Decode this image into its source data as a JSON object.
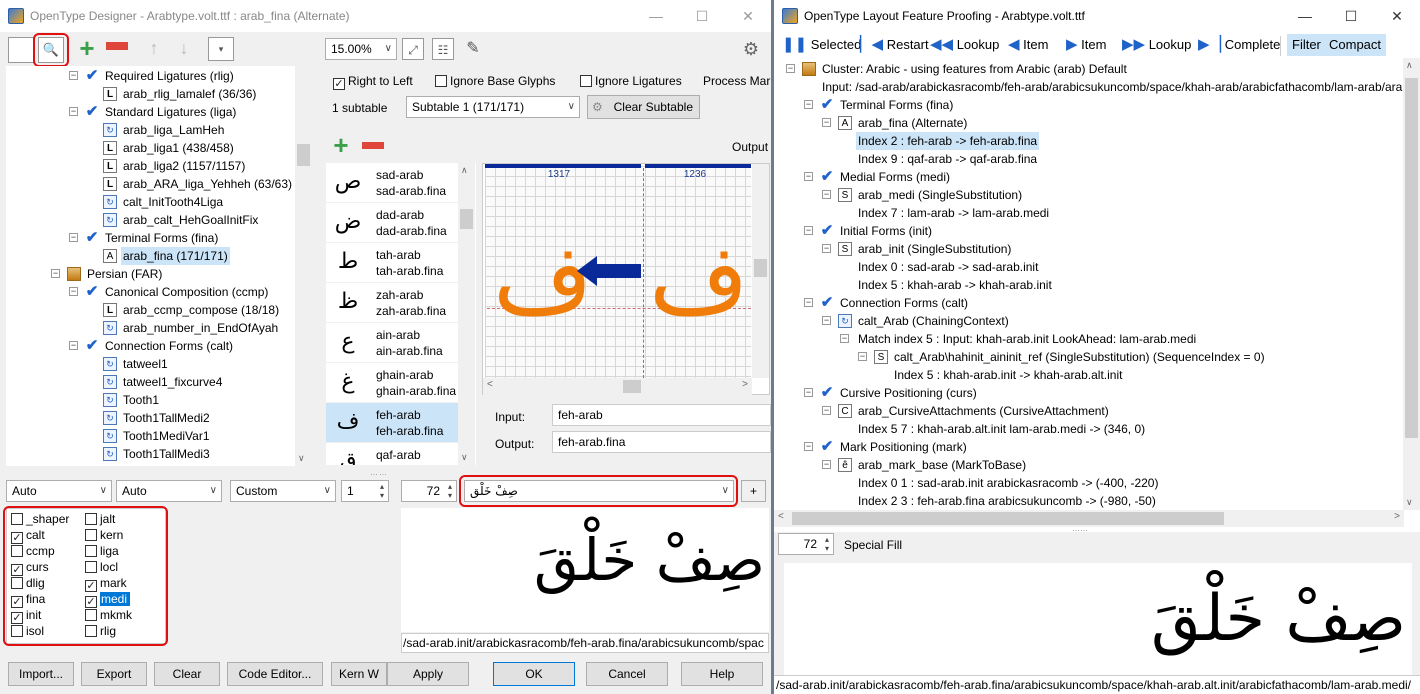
{
  "left_window": {
    "title": "OpenType Designer - Arabtype.volt.ttf : arab_fina (Alternate)",
    "zoom": "15.00%",
    "options": {
      "right_to_left": "Right to Left",
      "ignore_base_glyphs": "Ignore Base Glyphs",
      "ignore_ligatures": "Ignore Ligatures",
      "process_marks": "Process Mark"
    },
    "subtable_count": "1 subtable",
    "subtable_select": "Subtable 1 (171/171)",
    "clear_subtable": "Clear Subtable",
    "output_label": "Output",
    "tree": [
      {
        "label": "Required Ligatures (rlig)",
        "level": 1,
        "icon": "check",
        "toggle": "-"
      },
      {
        "label": "arab_rlig_lamalef (36/36)",
        "level": 2,
        "icon": "L"
      },
      {
        "label": "Standard Ligatures (liga)",
        "level": 1,
        "icon": "check",
        "toggle": "-"
      },
      {
        "label": "arab_liga_LamHeh",
        "level": 2,
        "icon": "sub"
      },
      {
        "label": "arab_liga1 (438/458)",
        "level": 2,
        "icon": "L"
      },
      {
        "label": "arab_liga2 (1157/1157)",
        "level": 2,
        "icon": "L"
      },
      {
        "label": "arab_ARA_liga_Yehheh (63/63)",
        "level": 2,
        "icon": "L"
      },
      {
        "label": "calt_InitTooth4Liga",
        "level": 2,
        "icon": "sub"
      },
      {
        "label": "arab_calt_HehGoalInitFix",
        "level": 2,
        "icon": "sub"
      },
      {
        "label": "Terminal Forms (fina)",
        "level": 1,
        "icon": "check",
        "toggle": "-"
      },
      {
        "label": "arab_fina (171/171)",
        "level": 2,
        "icon": "A",
        "selected": true
      },
      {
        "label": "Persian (FAR)",
        "level": 0,
        "icon": "lang",
        "toggle": "-"
      },
      {
        "label": "Canonical Composition (ccmp)",
        "level": 1,
        "icon": "check",
        "toggle": "-"
      },
      {
        "label": "arab_ccmp_compose (18/18)",
        "level": 2,
        "icon": "L"
      },
      {
        "label": "arab_number_in_EndOfAyah",
        "level": 2,
        "icon": "sub"
      },
      {
        "label": "Connection Forms (calt)",
        "level": 1,
        "icon": "check",
        "toggle": "-"
      },
      {
        "label": "tatweel1",
        "level": 2,
        "icon": "sub"
      },
      {
        "label": "tatweel1_fixcurve4",
        "level": 2,
        "icon": "sub"
      },
      {
        "label": "Tooth1",
        "level": 2,
        "icon": "sub"
      },
      {
        "label": "Tooth1TallMedi2",
        "level": 2,
        "icon": "sub"
      },
      {
        "label": "Tooth1MediVar1",
        "level": 2,
        "icon": "sub"
      },
      {
        "label": "Tooth1TallMedi3",
        "level": 2,
        "icon": "sub"
      }
    ],
    "glyphs": [
      {
        "sym": "ص",
        "in": "sad-arab",
        "out": "sad-arab.fina"
      },
      {
        "sym": "ض",
        "in": "dad-arab",
        "out": "dad-arab.fina"
      },
      {
        "sym": "ط",
        "in": "tah-arab",
        "out": "tah-arab.fina"
      },
      {
        "sym": "ظ",
        "in": "zah-arab",
        "out": "zah-arab.fina"
      },
      {
        "sym": "ع",
        "in": "ain-arab",
        "out": "ain-arab.fina"
      },
      {
        "sym": "غ",
        "in": "ghain-arab",
        "out": "ghain-arab.fina"
      },
      {
        "sym": "ف",
        "in": "feh-arab",
        "out": "feh-arab.fina",
        "selected": true
      },
      {
        "sym": "ق",
        "in": "qaf-arab",
        "out": ""
      }
    ],
    "preview": {
      "adv1": "1317",
      "adv2": "1236",
      "glyph_left": "ف",
      "glyph_right": "ف"
    },
    "input_label": "Input:",
    "input_value": "feh-arab",
    "output_field_label": "Output:",
    "output_value": "feh-arab.fina",
    "bottom_combos": {
      "script": "Auto",
      "lang": "Auto",
      "mode": "Custom",
      "count": "1",
      "size": "72",
      "text": "صِفْ خَلْق"
    },
    "plus_label": "+",
    "features": [
      {
        "tag": "_shaper",
        "checked": false
      },
      {
        "tag": "calt",
        "checked": true
      },
      {
        "tag": "ccmp",
        "checked": false
      },
      {
        "tag": "curs",
        "checked": true
      },
      {
        "tag": "dlig",
        "checked": false
      },
      {
        "tag": "fina",
        "checked": true
      },
      {
        "tag": "init",
        "checked": true
      },
      {
        "tag": "isol",
        "checked": false
      },
      {
        "tag": "jalt",
        "checked": false
      },
      {
        "tag": "kern",
        "checked": false
      },
      {
        "tag": "liga",
        "checked": false
      },
      {
        "tag": "locl",
        "checked": false
      },
      {
        "tag": "mark",
        "checked": true
      },
      {
        "tag": "medi",
        "checked": true,
        "selected": true
      },
      {
        "tag": "mkmk",
        "checked": false
      },
      {
        "tag": "rlig",
        "checked": false
      }
    ],
    "preview_text": "صِفْ خَلْقَ",
    "glyph_path": "/sad-arab.init/arabickasracomb/feh-arab.fina/arabicsukuncomb/spac",
    "buttons": {
      "import": "Import...",
      "export": "Export",
      "clear": "Clear",
      "code_editor": "Code Editor...",
      "kern": "Kern W",
      "apply": "Apply",
      "ok": "OK",
      "cancel": "Cancel",
      "help": "Help"
    }
  },
  "right_window": {
    "title": "OpenType Layout Feature Proofing - Arabtype.volt.ttf",
    "toolbar": {
      "selected": "Selected",
      "restart": "Restart",
      "lookup_back": "Lookup",
      "item_back": "Item",
      "item_fwd": "Item",
      "lookup_fwd": "Lookup",
      "complete": "Complete",
      "filter": "Filter",
      "compact": "Compact"
    },
    "tree": [
      {
        "label": "Cluster: Arabic - using features from Arabic (arab) Default",
        "level": 0,
        "icon": "lang",
        "toggle": "-"
      },
      {
        "label": "Input: /sad-arab/arabickasracomb/feh-arab/arabicsukuncomb/space/khah-arab/arabicfathacomb/lam-arab/ara",
        "level": 1,
        "icon": ""
      },
      {
        "label": "Terminal Forms (fina)",
        "level": 1,
        "icon": "check",
        "toggle": "-"
      },
      {
        "label": "arab_fina (Alternate)",
        "level": 2,
        "icon": "A",
        "toggle": "-"
      },
      {
        "label": "Index 2 : feh-arab -> feh-arab.fina",
        "level": 3,
        "icon": "",
        "selected": true
      },
      {
        "label": "Index 9 : qaf-arab -> qaf-arab.fina",
        "level": 3,
        "icon": ""
      },
      {
        "label": "Medial Forms (medi)",
        "level": 1,
        "icon": "check",
        "toggle": "-"
      },
      {
        "label": "arab_medi (SingleSubstitution)",
        "level": 2,
        "icon": "S",
        "toggle": "-"
      },
      {
        "label": "Index 7 : lam-arab -> lam-arab.medi",
        "level": 3,
        "icon": ""
      },
      {
        "label": "Initial Forms (init)",
        "level": 1,
        "icon": "check",
        "toggle": "-"
      },
      {
        "label": "arab_init (SingleSubstitution)",
        "level": 2,
        "icon": "S",
        "toggle": "-"
      },
      {
        "label": "Index 0 : sad-arab -> sad-arab.init",
        "level": 3,
        "icon": ""
      },
      {
        "label": "Index 5 : khah-arab -> khah-arab.init",
        "level": 3,
        "icon": ""
      },
      {
        "label": "Connection Forms (calt)",
        "level": 1,
        "icon": "check",
        "toggle": "-"
      },
      {
        "label": "calt_Arab (ChainingContext)",
        "level": 2,
        "icon": "sub",
        "toggle": "-"
      },
      {
        "label": "Match index 5 : Input: khah-arab.init LookAhead: lam-arab.medi",
        "level": 3,
        "icon": "",
        "toggle": "-"
      },
      {
        "label": "calt_Arab\\hahinit_aininit_ref (SingleSubstitution) (SequenceIndex = 0)",
        "level": 4,
        "icon": "S",
        "toggle": "-"
      },
      {
        "label": "Index 5 : khah-arab.init -> khah-arab.alt.init",
        "level": 5,
        "icon": ""
      },
      {
        "label": "Cursive Positioning (curs)",
        "level": 1,
        "icon": "check",
        "toggle": "-"
      },
      {
        "label": "arab_CursiveAttachments (CursiveAttachment)",
        "level": 2,
        "icon": "C",
        "toggle": "-"
      },
      {
        "label": "Index 5 7 : khah-arab.alt.init lam-arab.medi -> (346, 0)",
        "level": 3,
        "icon": ""
      },
      {
        "label": "Mark Positioning (mark)",
        "level": 1,
        "icon": "check",
        "toggle": "-"
      },
      {
        "label": "arab_mark_base (MarkToBase)",
        "level": 2,
        "icon": "ê",
        "toggle": "-"
      },
      {
        "label": "Index 0 1 : sad-arab.init arabickasracomb -> (-400, -220)",
        "level": 3,
        "icon": ""
      },
      {
        "label": "Index 2 3 : feh-arab.fina arabicsukuncomb -> (-980, -50)",
        "level": 3,
        "icon": ""
      }
    ],
    "font_size": "72",
    "special_fill": "Special Fill",
    "preview_text": "صِفْ خَلْقَ",
    "glyph_path": "/sad-arab.init/arabickasracomb/feh-arab.fina/arabicsukuncomb/space/khah-arab.alt.init/arabicfathacomb/lam-arab.medi/"
  }
}
